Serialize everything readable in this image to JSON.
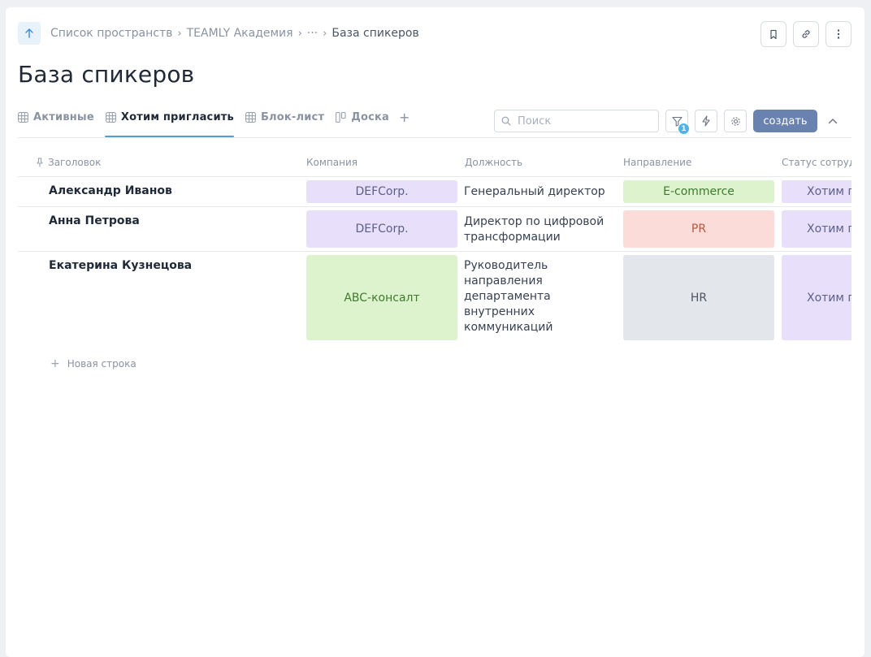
{
  "breadcrumb": {
    "items": [
      "Список пространств",
      "TEAMLY Академия",
      "···",
      "База спикеров"
    ]
  },
  "page": {
    "title": "База спикеров"
  },
  "tabs": [
    {
      "label": "Активные",
      "icon": "table-icon",
      "active": false
    },
    {
      "label": "Хотим пригласить",
      "icon": "table-icon",
      "active": true
    },
    {
      "label": "Блок-лист",
      "icon": "table-icon",
      "active": false
    },
    {
      "label": "Доска",
      "icon": "board-icon",
      "active": false
    }
  ],
  "tabs_add": "+",
  "toolbar": {
    "search_placeholder": "Поиск",
    "filter_count": "1",
    "create_label": "создать"
  },
  "table": {
    "columns": [
      "Заголовок",
      "Компания",
      "Должность",
      "Направление",
      "Статус сотрудн"
    ],
    "rows": [
      {
        "title": "Александр Иванов",
        "company": "DEFCorp.",
        "role": "Генеральный директор",
        "direction": "E-commerce",
        "status": "Хотим пр"
      },
      {
        "title": "Анна Петрова",
        "company": "DEFCorp.",
        "role": "Директор по цифровой трансформации",
        "direction": "PR",
        "status": "Хотим пр"
      },
      {
        "title": "Екатерина Кузнецова",
        "company": "ABC-консалт",
        "role": "Руководитель направления департамента внутренних коммуникаций",
        "direction": "HR",
        "status": "Хотим пр"
      }
    ],
    "new_row_label": "Новая строка"
  },
  "colors": {
    "tag_purple": "#e8e0fb",
    "tag_green": "#dcf3cd",
    "tag_red": "#fcdcd8",
    "tag_gray": "#e3e6ea",
    "text_purple": "#5b5f86",
    "text_green": "#3f7a2e",
    "text_red": "#b15a3e",
    "text_gray": "#4b5563",
    "accent": "#6a82b0"
  }
}
